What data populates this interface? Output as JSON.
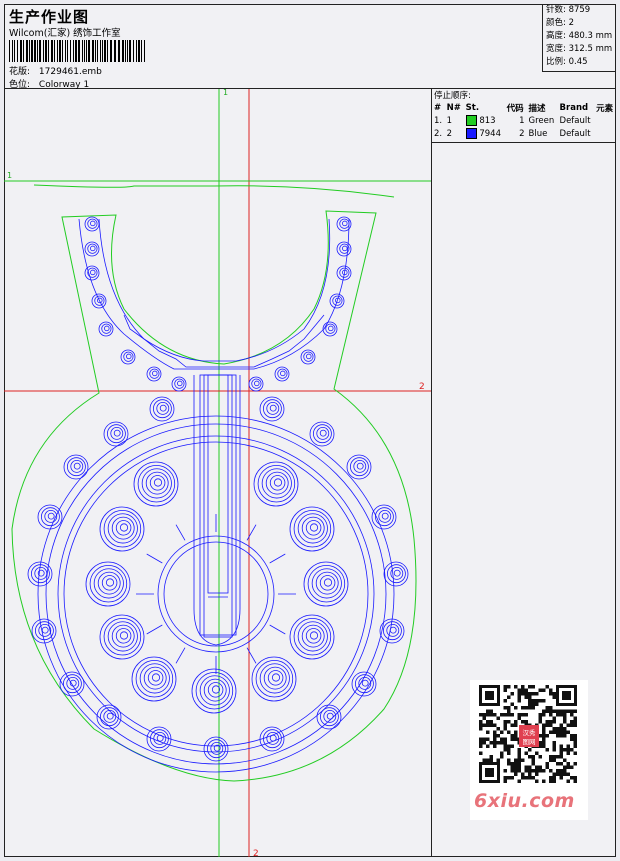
{
  "header": {
    "title": "生产作业图",
    "studio": "Wilcom(汇家) 绣饰工作室",
    "design_label": "花版:",
    "design_file": "1729461.emb",
    "colorway_label": "色位:",
    "colorway": "Colorway 1"
  },
  "stats": [
    {
      "label": "针数:",
      "value": "8759"
    },
    {
      "label": "颜色:",
      "value": "2"
    },
    {
      "label": "高度:",
      "value": "480.3 mm"
    },
    {
      "label": "宽度:",
      "value": "312.5 mm"
    },
    {
      "label": "比例:",
      "value": "0.45"
    }
  ],
  "stop_sequence": {
    "title": "停止顺序:",
    "columns": [
      "#",
      "N#",
      "St.",
      "代码",
      "描述",
      "Brand",
      "元素"
    ],
    "rows": [
      {
        "index": "1.",
        "needle": "1",
        "color": "#22cc22",
        "stitches": "813",
        "code": "1",
        "desc": "Green",
        "brand": "Default"
      },
      {
        "index": "2.",
        "needle": "2",
        "color": "#1a1aff",
        "stitches": "7944",
        "code": "2",
        "desc": "Blue",
        "brand": "Default"
      }
    ]
  },
  "guides": {
    "v_top": "1",
    "v_bottom": "2",
    "h_left": "1",
    "h_right": "2"
  },
  "watermark": {
    "site": "6xiu.com",
    "stamp": "汉秀图网"
  },
  "colors": {
    "green_outline": "#22cc22",
    "blue_stitch": "#1a1aff",
    "guide_red": "#dd2222"
  }
}
